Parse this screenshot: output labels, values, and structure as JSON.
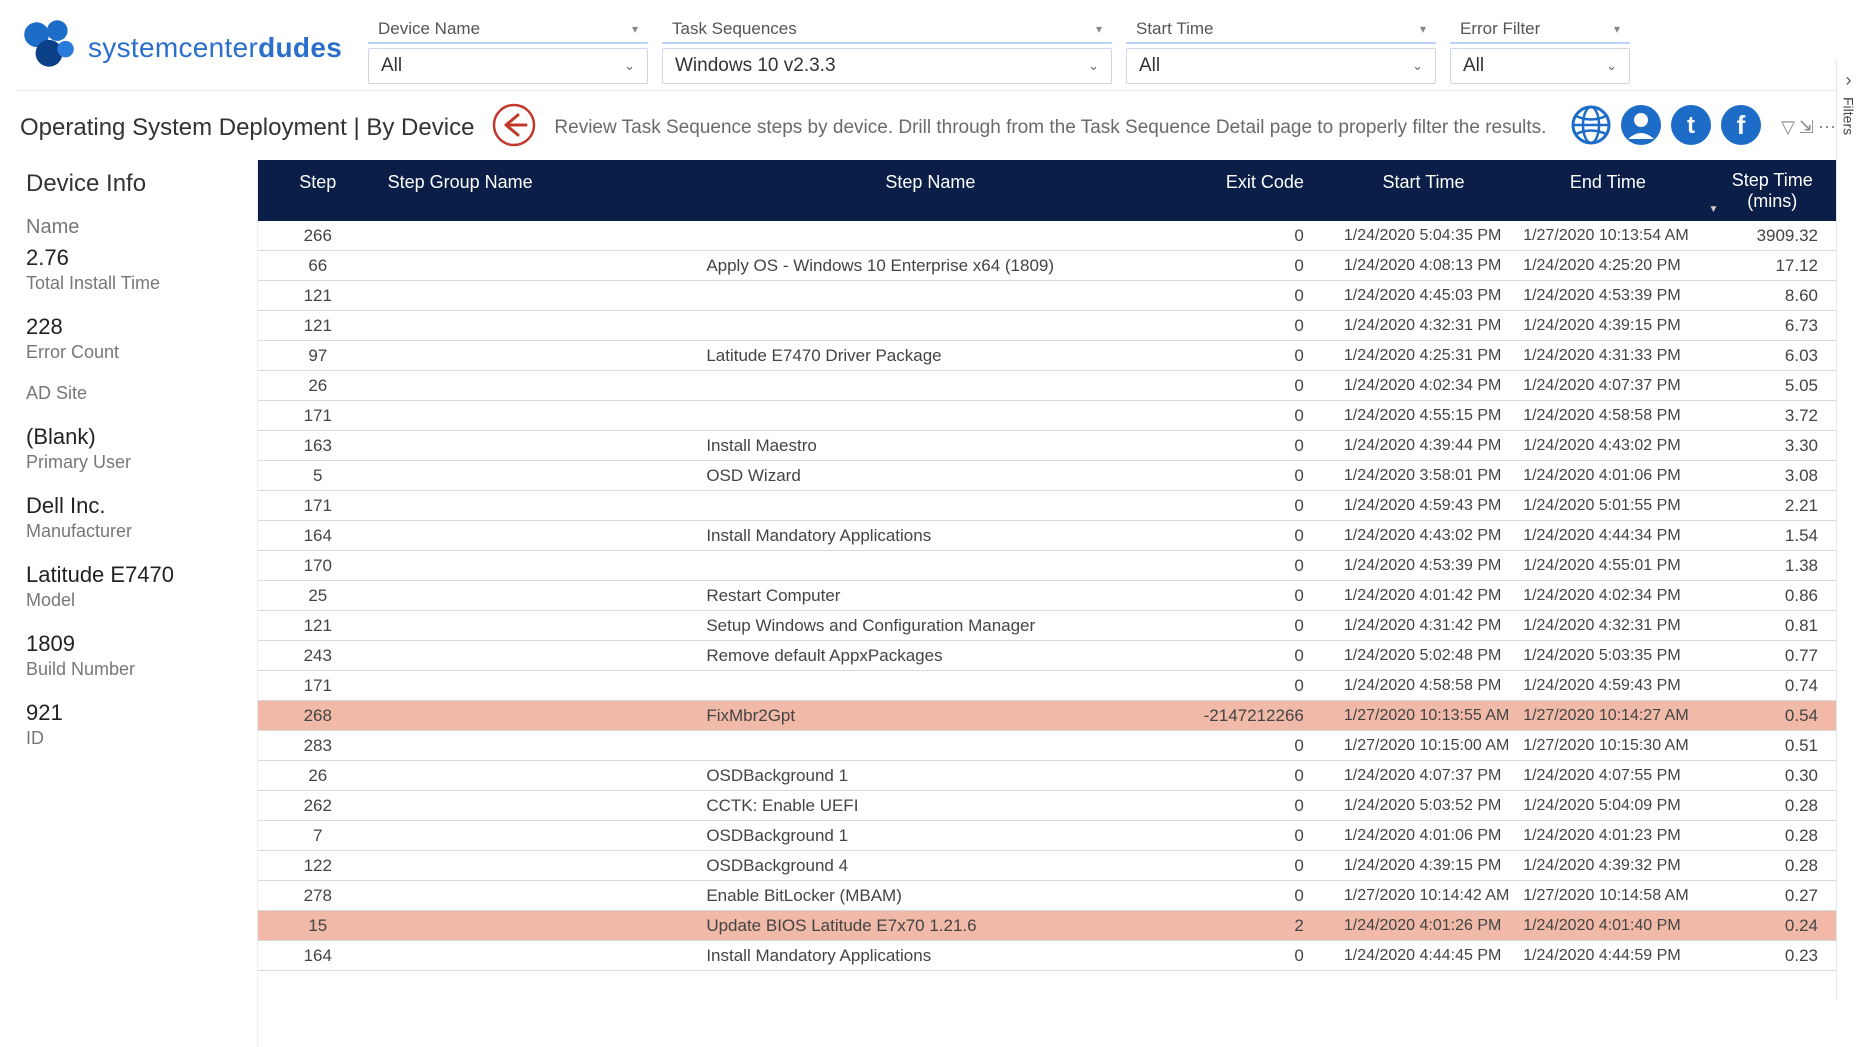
{
  "brand": {
    "name_light": "systemcenter",
    "name_bold": "dudes"
  },
  "filters": {
    "device_name": {
      "label": "Device Name",
      "value": "All"
    },
    "task_sequences": {
      "label": "Task Sequences",
      "value": "Windows 10 v2.3.3"
    },
    "start_time": {
      "label": "Start Time",
      "value": "All"
    },
    "error_filter": {
      "label": "Error Filter",
      "value": "All"
    }
  },
  "side_tab": {
    "label": "Filters"
  },
  "subhdr": {
    "page_title": "Operating System Deployment | By Device",
    "subtitle": "Review Task Sequence steps by device. Drill through from the Task Sequence Detail page to properly filter the results."
  },
  "info": {
    "title": "Device Info",
    "name_label": "Name",
    "total_install_time": {
      "value": "2.76",
      "label": "Total Install Time"
    },
    "error_count": {
      "value": "228",
      "label": "Error Count"
    },
    "ad_site": {
      "value": "",
      "label": "AD Site"
    },
    "primary_user": {
      "value": "(Blank)",
      "label": "Primary User"
    },
    "manufacturer": {
      "value": "Dell Inc.",
      "label": "Manufacturer"
    },
    "model": {
      "value": "Latitude E7470",
      "label": "Model"
    },
    "build_number": {
      "value": "1809",
      "label": "Build Number"
    },
    "id": {
      "value": "921",
      "label": "ID"
    }
  },
  "table": {
    "headers": {
      "step": "Step",
      "group": "Step Group Name",
      "name": "Step Name",
      "exit": "Exit Code",
      "start": "Start Time",
      "end": "End Time",
      "mins1": "Step Time",
      "mins2": "(mins)"
    },
    "rows": [
      {
        "step": "266",
        "group": "",
        "name": "",
        "exit": "0",
        "start": "1/24/2020 5:04:35 PM",
        "end": "1/27/2020 10:13:54 AM",
        "mins": "3909.32",
        "err": false
      },
      {
        "step": "66",
        "group": "",
        "name": "Apply OS - Windows 10 Enterprise x64 (1809)",
        "exit": "0",
        "start": "1/24/2020 4:08:13 PM",
        "end": "1/24/2020 4:25:20 PM",
        "mins": "17.12",
        "err": false
      },
      {
        "step": "121",
        "group": "",
        "name": "",
        "exit": "0",
        "start": "1/24/2020 4:45:03 PM",
        "end": "1/24/2020 4:53:39 PM",
        "mins": "8.60",
        "err": false
      },
      {
        "step": "121",
        "group": "",
        "name": "",
        "exit": "0",
        "start": "1/24/2020 4:32:31 PM",
        "end": "1/24/2020 4:39:15 PM",
        "mins": "6.73",
        "err": false
      },
      {
        "step": "97",
        "group": "",
        "name": "Latitude E7470 Driver Package",
        "exit": "0",
        "start": "1/24/2020 4:25:31 PM",
        "end": "1/24/2020 4:31:33 PM",
        "mins": "6.03",
        "err": false
      },
      {
        "step": "26",
        "group": "",
        "name": "",
        "exit": "0",
        "start": "1/24/2020 4:02:34 PM",
        "end": "1/24/2020 4:07:37 PM",
        "mins": "5.05",
        "err": false
      },
      {
        "step": "171",
        "group": "",
        "name": "",
        "exit": "0",
        "start": "1/24/2020 4:55:15 PM",
        "end": "1/24/2020 4:58:58 PM",
        "mins": "3.72",
        "err": false
      },
      {
        "step": "163",
        "group": "",
        "name": "Install Maestro",
        "exit": "0",
        "start": "1/24/2020 4:39:44 PM",
        "end": "1/24/2020 4:43:02 PM",
        "mins": "3.30",
        "err": false
      },
      {
        "step": "5",
        "group": "",
        "name": "OSD Wizard",
        "exit": "0",
        "start": "1/24/2020 3:58:01 PM",
        "end": "1/24/2020 4:01:06 PM",
        "mins": "3.08",
        "err": false
      },
      {
        "step": "171",
        "group": "",
        "name": "",
        "exit": "0",
        "start": "1/24/2020 4:59:43 PM",
        "end": "1/24/2020 5:01:55 PM",
        "mins": "2.21",
        "err": false
      },
      {
        "step": "164",
        "group": "",
        "name": "Install Mandatory Applications",
        "exit": "0",
        "start": "1/24/2020 4:43:02 PM",
        "end": "1/24/2020 4:44:34 PM",
        "mins": "1.54",
        "err": false
      },
      {
        "step": "170",
        "group": "",
        "name": "",
        "exit": "0",
        "start": "1/24/2020 4:53:39 PM",
        "end": "1/24/2020 4:55:01 PM",
        "mins": "1.38",
        "err": false
      },
      {
        "step": "25",
        "group": "",
        "name": "Restart Computer",
        "exit": "0",
        "start": "1/24/2020 4:01:42 PM",
        "end": "1/24/2020 4:02:34 PM",
        "mins": "0.86",
        "err": false
      },
      {
        "step": "121",
        "group": "",
        "name": "Setup Windows and Configuration Manager",
        "exit": "0",
        "start": "1/24/2020 4:31:42 PM",
        "end": "1/24/2020 4:32:31 PM",
        "mins": "0.81",
        "err": false
      },
      {
        "step": "243",
        "group": "",
        "name": "Remove default AppxPackages",
        "exit": "0",
        "start": "1/24/2020 5:02:48 PM",
        "end": "1/24/2020 5:03:35 PM",
        "mins": "0.77",
        "err": false
      },
      {
        "step": "171",
        "group": "",
        "name": "",
        "exit": "0",
        "start": "1/24/2020 4:58:58 PM",
        "end": "1/24/2020 4:59:43 PM",
        "mins": "0.74",
        "err": false
      },
      {
        "step": "268",
        "group": "",
        "name": "FixMbr2Gpt",
        "exit": "-2147212266",
        "start": "1/27/2020 10:13:55 AM",
        "end": "1/27/2020 10:14:27 AM",
        "mins": "0.54",
        "err": true
      },
      {
        "step": "283",
        "group": "",
        "name": "",
        "exit": "0",
        "start": "1/27/2020 10:15:00 AM",
        "end": "1/27/2020 10:15:30 AM",
        "mins": "0.51",
        "err": false
      },
      {
        "step": "26",
        "group": "",
        "name": "OSDBackground 1",
        "exit": "0",
        "start": "1/24/2020 4:07:37 PM",
        "end": "1/24/2020 4:07:55 PM",
        "mins": "0.30",
        "err": false
      },
      {
        "step": "262",
        "group": "",
        "name": "CCTK: Enable UEFI",
        "exit": "0",
        "start": "1/24/2020 5:03:52 PM",
        "end": "1/24/2020 5:04:09 PM",
        "mins": "0.28",
        "err": false
      },
      {
        "step": "7",
        "group": "",
        "name": "OSDBackground 1",
        "exit": "0",
        "start": "1/24/2020 4:01:06 PM",
        "end": "1/24/2020 4:01:23 PM",
        "mins": "0.28",
        "err": false
      },
      {
        "step": "122",
        "group": "",
        "name": "OSDBackground 4",
        "exit": "0",
        "start": "1/24/2020 4:39:15 PM",
        "end": "1/24/2020 4:39:32 PM",
        "mins": "0.28",
        "err": false
      },
      {
        "step": "278",
        "group": "",
        "name": "Enable BitLocker (MBAM)",
        "exit": "0",
        "start": "1/27/2020 10:14:42 AM",
        "end": "1/27/2020 10:14:58 AM",
        "mins": "0.27",
        "err": false
      },
      {
        "step": "15",
        "group": "",
        "name": "Update BIOS Latitude E7x70 1.21.6",
        "exit": "2",
        "start": "1/24/2020 4:01:26 PM",
        "end": "1/24/2020 4:01:40 PM",
        "mins": "0.24",
        "err": true
      },
      {
        "step": "164",
        "group": "",
        "name": "Install Mandatory Applications",
        "exit": "0",
        "start": "1/24/2020 4:44:45 PM",
        "end": "1/24/2020 4:44:59 PM",
        "mins": "0.23",
        "err": false
      }
    ]
  }
}
